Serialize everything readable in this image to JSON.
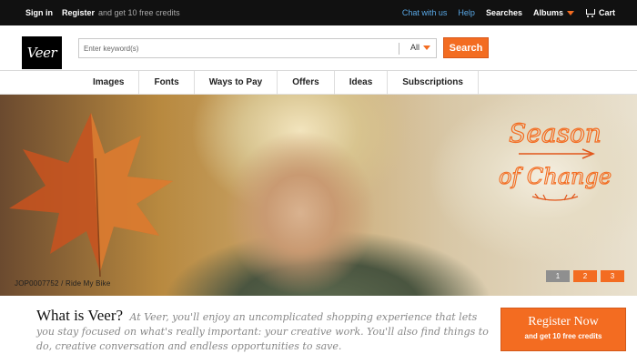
{
  "topbar": {
    "signin": "Sign in",
    "register": "Register",
    "register_suffix": "and get 10 free credits",
    "chat": "Chat with us",
    "help": "Help",
    "searches": "Searches",
    "albums": "Albums",
    "cart": "Cart"
  },
  "header": {
    "logo": "Veer",
    "search_placeholder": "Enter keyword(s)",
    "search_scope": "All",
    "search_button": "Search"
  },
  "nav": {
    "items": [
      "Images",
      "Fonts",
      "Ways to Pay",
      "Offers",
      "Ideas",
      "Subscriptions"
    ]
  },
  "hero": {
    "caption": "JOP0007752 / Ride My Bike",
    "overlay_line1": "Season",
    "overlay_line2": "of Change",
    "pages": [
      "1",
      "2",
      "3"
    ],
    "active_page": "3"
  },
  "promo": {
    "headline": "What is Veer?",
    "body": "At Veer, you'll enjoy an uncomplicated shopping experience that lets you stay focused on what's really important: your creative work. You'll also find things to do, creative conversation and endless opportunities to save.",
    "button_title": "Register Now",
    "button_subtitle": "and get 10 free credits"
  },
  "colors": {
    "accent": "#f36c21",
    "topbar_bg": "#111111",
    "link_blue": "#59a8e6"
  }
}
